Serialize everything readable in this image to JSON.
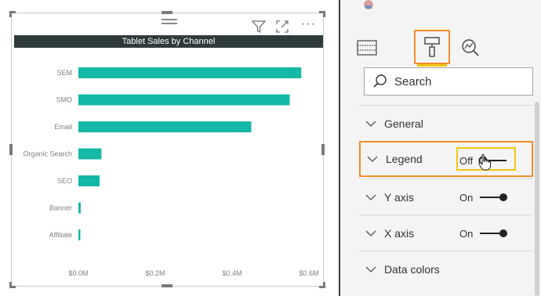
{
  "chart_data": {
    "type": "bar",
    "orientation": "horizontal",
    "title": "Tablet Sales by Channel",
    "categories": [
      "SEM",
      "SMO",
      "Email",
      "Organic Search",
      "SEO",
      "Banner",
      "Affiliate"
    ],
    "values": [
      0.58,
      0.55,
      0.45,
      0.06,
      0.055,
      0.006,
      0.005
    ],
    "xlim": [
      0,
      0.6
    ],
    "x_ticks": [
      "$0.0M",
      "$0.2M",
      "$0.4M",
      "$0.6M"
    ],
    "xlabel": "",
    "ylabel": "",
    "grid": false,
    "bar_color": "#14b8a6"
  },
  "visual": {
    "filter_icon": "filter-icon",
    "focus_icon": "focus-mode-icon",
    "more_label": "···"
  },
  "pane": {
    "tabs": [
      {
        "icon": "fields-icon"
      },
      {
        "icon": "paint-roller-icon",
        "selected": true
      },
      {
        "icon": "analytics-icon"
      }
    ],
    "search_placeholder": "Search",
    "sections": {
      "general": {
        "label": "General"
      },
      "legend": {
        "label": "Legend",
        "toggle": "Off"
      },
      "yaxis": {
        "label": "Y axis",
        "toggle": "On"
      },
      "xaxis": {
        "label": "X axis",
        "toggle": "On"
      },
      "colors": {
        "label": "Data colors"
      }
    },
    "accent_orange": "#f28c28",
    "accent_yellow": "#f2c811"
  }
}
